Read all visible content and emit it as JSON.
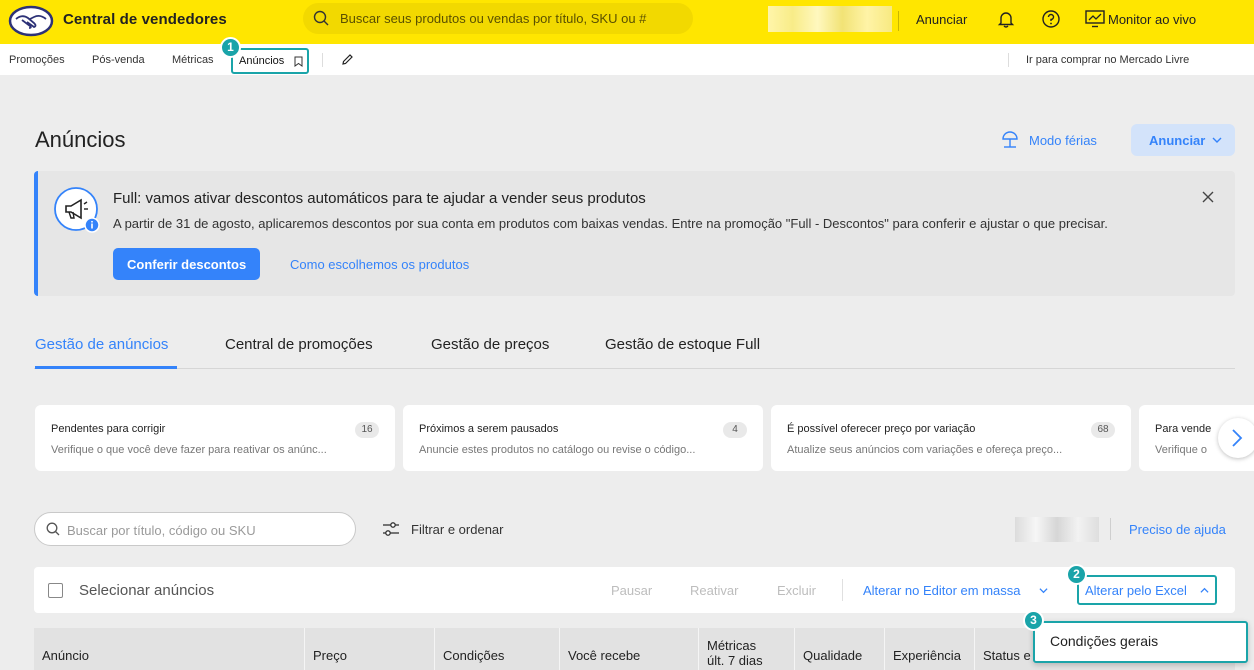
{
  "header": {
    "brand": "Central de vendedores",
    "search_placeholder": "Buscar seus produtos ou vendas por título, SKU ou #",
    "anunciar": "Anunciar",
    "monitor": "Monitor ao vivo"
  },
  "subnav": {
    "items": [
      "Promoções",
      "Pós-venda",
      "Métricas",
      "Anúncios"
    ],
    "go_buy": "Ir para comprar no Mercado Livre"
  },
  "badges": [
    "1",
    "2",
    "3"
  ],
  "page": {
    "title": "Anúncios",
    "vacation": "Modo férias",
    "anunciar_button": "Anunciar"
  },
  "banner": {
    "title": "Full: vamos ativar descontos automáticos para te ajudar a vender seus produtos",
    "body": "A partir de 31 de agosto, aplicaremos descontos por sua conta em produtos com baixas vendas. Entre na promoção \"Full - Descontos\" para conferir e ajustar o que precisar.",
    "cta": "Conferir descontos",
    "link": "Como escolhemos os produtos"
  },
  "tabs": [
    "Gestão de anúncios",
    "Central de promoções",
    "Gestão de preços",
    "Gestão de estoque Full"
  ],
  "cards": [
    {
      "title": "Pendentes para corrigir",
      "desc": "Verifique o que você deve fazer para reativar os anúnc...",
      "count": "16"
    },
    {
      "title": "Próximos a serem pausados",
      "desc": "Anuncie estes produtos no catálogo ou revise o código...",
      "count": "4"
    },
    {
      "title": "É possível oferecer preço por variação",
      "desc": "Atualize seus anúncios com variações e ofereça preço...",
      "count": "68"
    },
    {
      "title": "Para vende",
      "desc": "Verifique o"
    }
  ],
  "toolbar": {
    "search_placeholder": "Buscar por título, código ou SKU",
    "filter": "Filtrar e ordenar",
    "help": "Preciso de ajuda"
  },
  "actions": {
    "select": "Selecionar anúncios",
    "pause": "Pausar",
    "reactivate": "Reativar",
    "delete": "Excluir",
    "bulk_editor": "Alterar no Editor em massa",
    "excel": "Alterar pelo Excel"
  },
  "table_headers": [
    "Anúncio",
    "Preço",
    "Condições",
    "Você recebe",
    "Métricas",
    "últ. 7 dias",
    "Qualidade",
    "Experiência",
    "Status e"
  ],
  "dropdown": {
    "item": "Condições gerais"
  },
  "colors": {
    "brand_yellow": "#ffe600",
    "accent_blue": "#3483fa",
    "highlight_teal": "#1aa4a9"
  }
}
